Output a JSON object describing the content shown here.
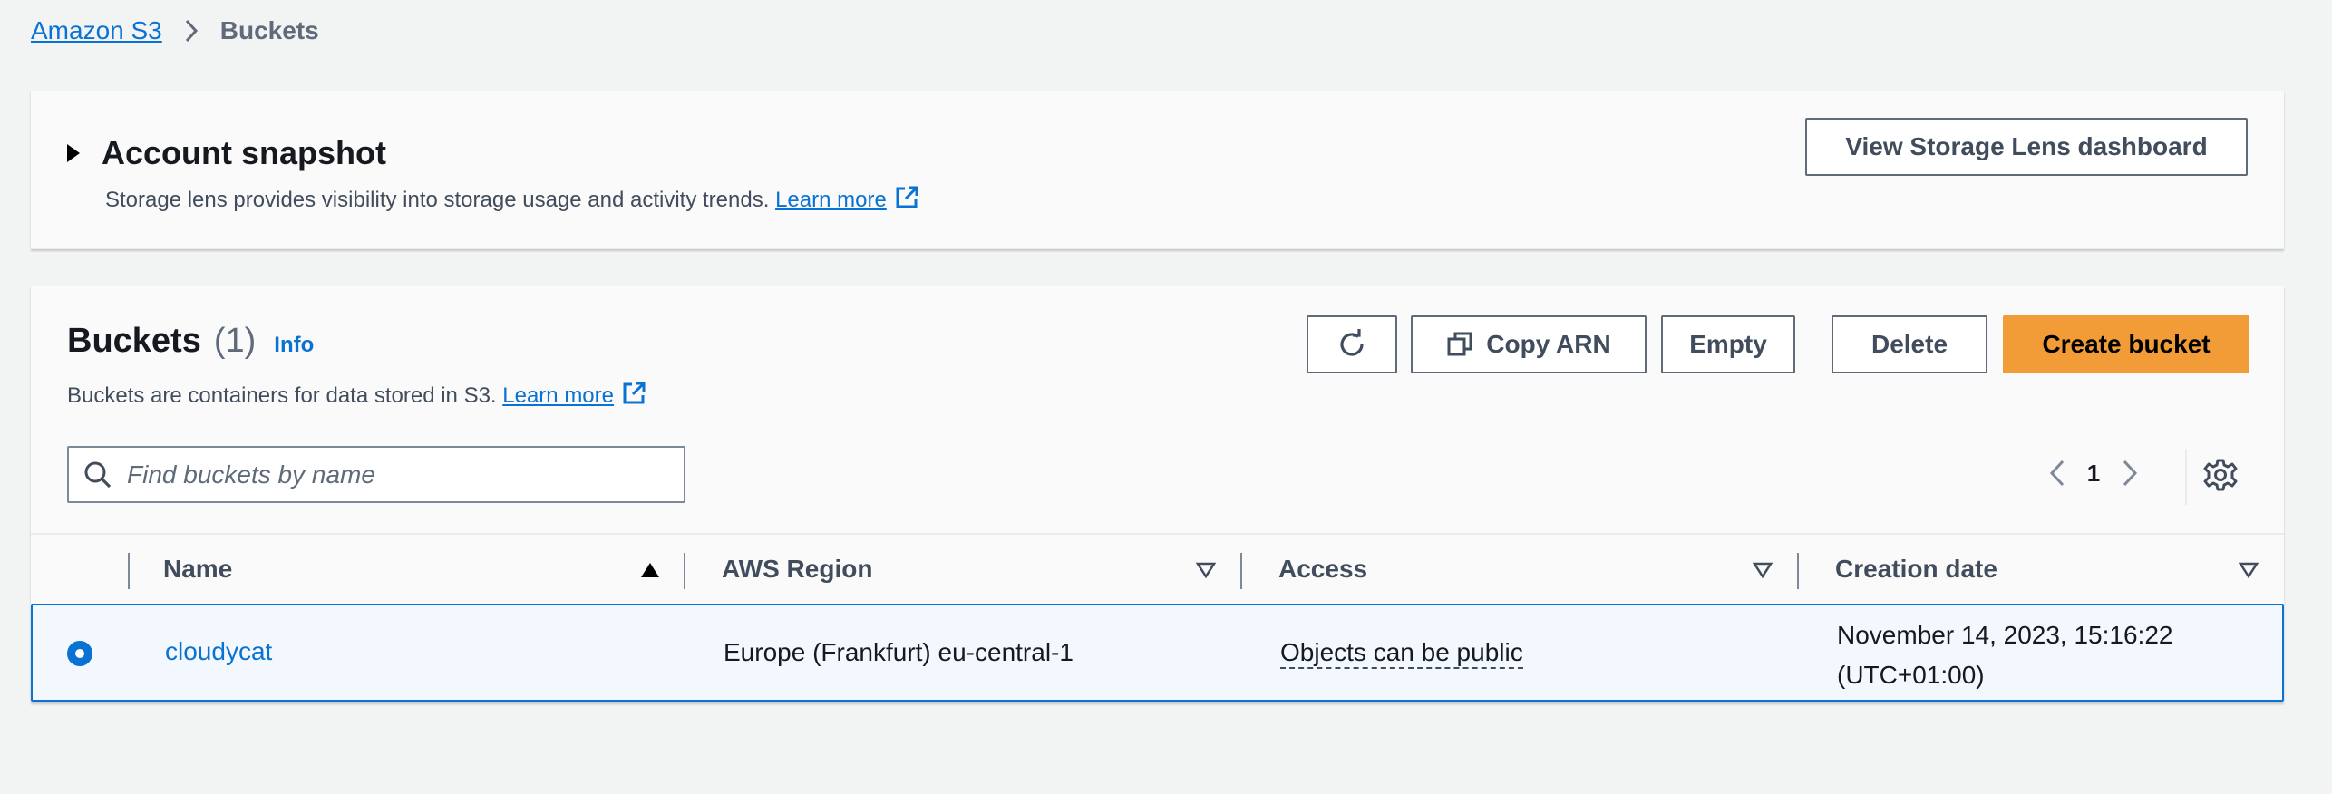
{
  "breadcrumb": {
    "root": "Amazon S3",
    "current": "Buckets"
  },
  "snapshot": {
    "title": "Account snapshot",
    "description": "Storage lens provides visibility into storage usage and activity trends.",
    "learn_more": "Learn more",
    "lens_button": "View Storage Lens dashboard"
  },
  "buckets": {
    "title": "Buckets",
    "count": "(1)",
    "info": "Info",
    "description": "Buckets are containers for data stored in S3.",
    "learn_more": "Learn more",
    "actions": {
      "copy_arn": "Copy ARN",
      "empty": "Empty",
      "delete": "Delete",
      "create": "Create bucket"
    },
    "search_placeholder": "Find buckets by name",
    "page": "1",
    "columns": [
      "Name",
      "AWS Region",
      "Access",
      "Creation date"
    ],
    "rows": [
      {
        "name": "cloudycat",
        "region": "Europe (Frankfurt) eu-central-1",
        "access": "Objects can be public",
        "created_line1": "November 14, 2023, 15:16:22",
        "created_line2": "(UTC+01:00)",
        "selected": true
      }
    ]
  },
  "colors": {
    "link": "#0972d3",
    "primary_button": "#f29c38",
    "selected_row": "#f2f8fd"
  }
}
